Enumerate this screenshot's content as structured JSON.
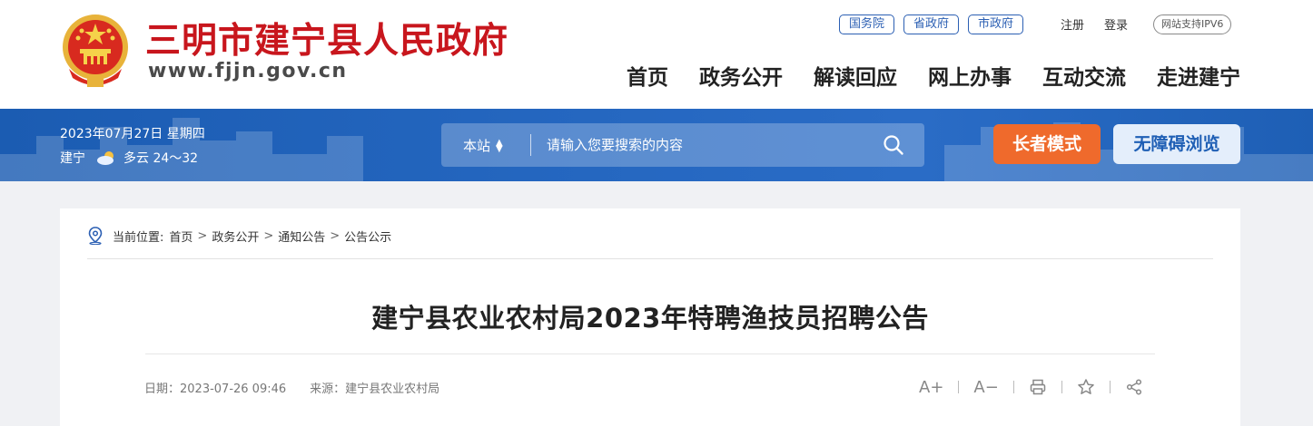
{
  "header": {
    "site_name": "三明市建宁县人民政府",
    "site_url": "www.fjjn.gov.cn",
    "top_links": [
      "国务院",
      "省政府",
      "市政府"
    ],
    "register": "注册",
    "login": "登录",
    "ipv6": "网站支持IPV6",
    "nav": [
      "首页",
      "政务公开",
      "解读回应",
      "网上办事",
      "互动交流",
      "走进建宁"
    ]
  },
  "banner": {
    "date": "2023年07月27日 星期四",
    "city": "建宁",
    "weather": "多云 24～32",
    "search_scope": "本站",
    "search_placeholder": "请输入您要搜索的内容",
    "elder_mode": "长者模式",
    "accessible": "无障碍浏览"
  },
  "article": {
    "breadcrumb_label": "当前位置:",
    "breadcrumb": [
      "首页",
      "政务公开",
      "通知公告",
      "公告公示"
    ],
    "title": "建宁县农业农村局2023年特聘渔技员招聘公告",
    "date": "日期：2023-07-26 09:46",
    "source": "来源：建宁县农业农村局",
    "font_larger": "A+",
    "font_smaller": "A−"
  },
  "colors": {
    "brand_red": "#c8161d",
    "banner_blue": "#1b5cb2",
    "elder_orange": "#ef6a2c",
    "link_blue": "#2b5fb3"
  }
}
